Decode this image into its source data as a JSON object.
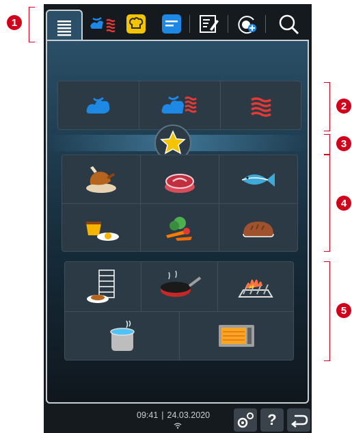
{
  "callouts": [
    "1",
    "2",
    "3",
    "4",
    "5"
  ],
  "colors": {
    "callout": "#d0021b",
    "steam_blue": "#1e88e5",
    "heat_red": "#e53935",
    "accent_yellow": "#f5c400"
  },
  "tabs": [
    {
      "icon": "menu-lines-icon",
      "active": true
    },
    {
      "icon": "steam-heat-icon"
    },
    {
      "icon": "chef-hat-icon"
    },
    {
      "icon": "program-list-icon"
    },
    {
      "icon": "edit-note-icon"
    },
    {
      "icon": "add-program-icon"
    },
    {
      "icon": "search-icon"
    }
  ],
  "modes": [
    "steam-icon",
    "combi-steam-heat-icon",
    "dry-heat-icon"
  ],
  "favorites_icon": "star-icon",
  "food_categories": [
    "poultry-icon",
    "meat-icon",
    "fish-icon",
    "egg-dessert-icon",
    "vegetables-icon",
    "bread-icon"
  ],
  "cooking_methods": [
    "finishing-rack-icon",
    "pan-frying-icon",
    "grilling-icon",
    "boiling-pot-icon",
    "oven-icon"
  ],
  "status": {
    "time": "09:41",
    "date": "24.03.2020",
    "separator": "|"
  },
  "footer": {
    "help_label": "?"
  }
}
